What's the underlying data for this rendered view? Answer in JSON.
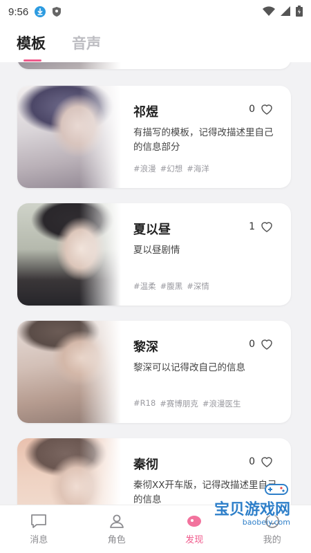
{
  "status_bar": {
    "time": "9:56"
  },
  "tabs": [
    {
      "label": "模板",
      "active": true
    },
    {
      "label": "音声",
      "active": false
    }
  ],
  "cards": [
    {
      "title": "祁煜",
      "likes": "0",
      "description": "有描写的模板，记得改描述里自己的信息部分",
      "tags": [
        "#浪漫",
        "#幻想",
        "#海洋"
      ],
      "image": "portrait-illustration"
    },
    {
      "title": "夏以昼",
      "likes": "1",
      "description": "夏以昼剧情",
      "tags": [
        "#温柔",
        "#腹黑",
        "#深情"
      ],
      "image": "portrait-illustration"
    },
    {
      "title": "黎深",
      "likes": "0",
      "description": "黎深可以记得改自己的信息",
      "tags": [
        "#R18",
        "#赛博朋克",
        "#浪漫医生"
      ],
      "image": "portrait-illustration"
    },
    {
      "title": "秦彻",
      "likes": "0",
      "description": "秦彻XX开车版，记得改描述里自己的信息",
      "tags": [],
      "image": "portrait-illustration"
    }
  ],
  "bottom_nav": [
    {
      "label": "消息",
      "icon": "chat-icon",
      "active": false
    },
    {
      "label": "角色",
      "icon": "person-icon",
      "active": false
    },
    {
      "label": "发现",
      "icon": "discover-icon",
      "active": true
    },
    {
      "label": "我的",
      "icon": "profile-icon",
      "active": false
    }
  ],
  "watermark": {
    "text": "宝贝游戏网",
    "url": "baobeiy.com"
  },
  "colors": {
    "accent": "#f05a8c",
    "background": "#f2f2f4"
  }
}
